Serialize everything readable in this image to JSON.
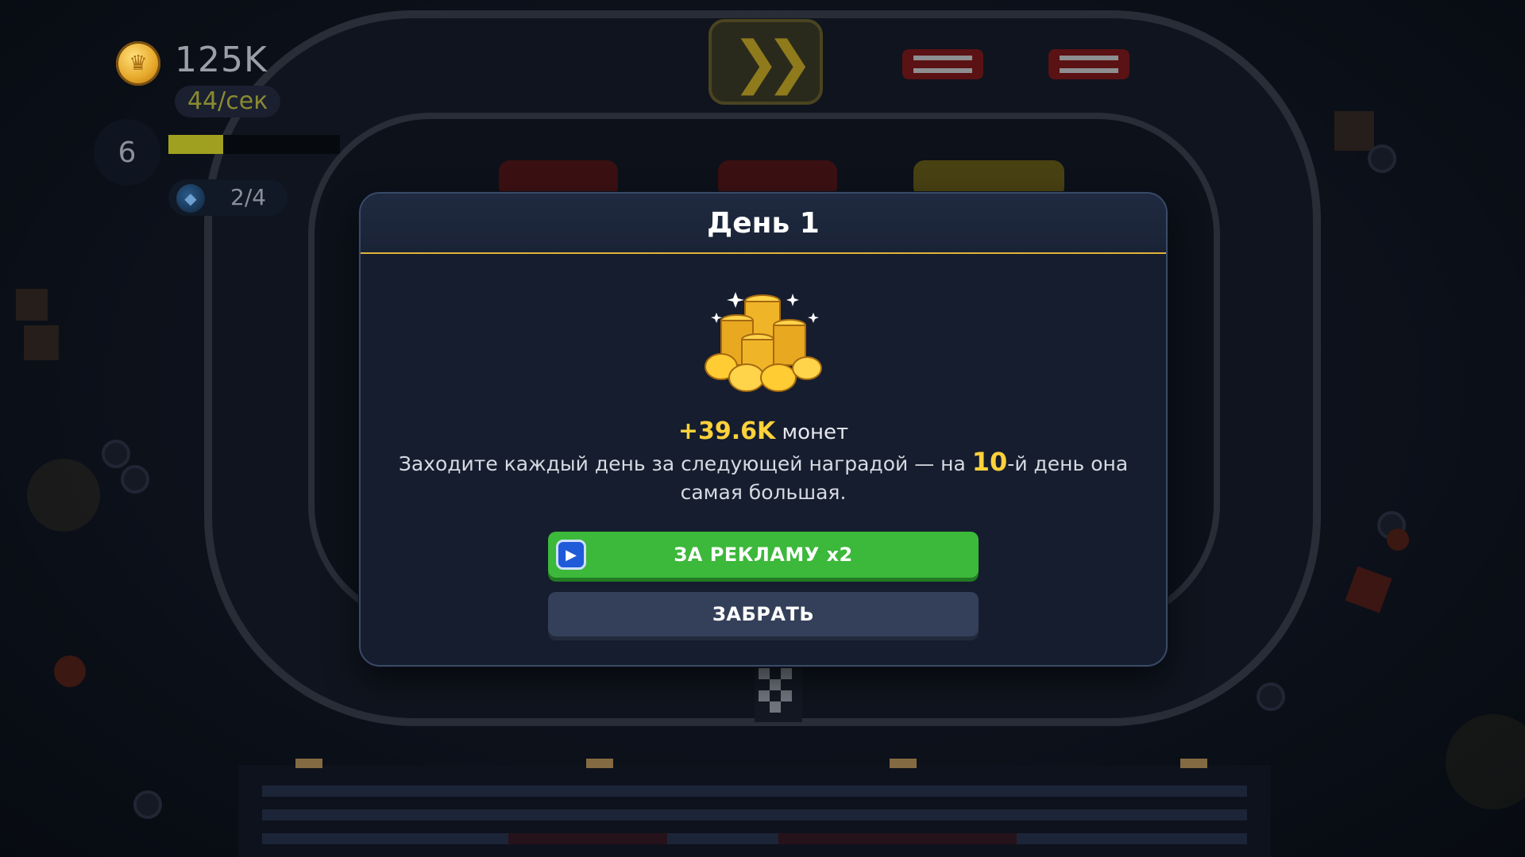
{
  "hud": {
    "coins": "125K",
    "rate": "44/сек",
    "level": "6",
    "xp_progress_fraction": 0.32,
    "gems": "2/4",
    "coin_icon": "crown-coin-icon",
    "gem_icon": "blue-gem-icon",
    "speed_icon": "fast-forward-icon"
  },
  "modal": {
    "title": "День 1",
    "reward_icon": "coin-pile-icon",
    "reward_amount": "+39.6K",
    "reward_unit": "монет",
    "desc_before": "Заходите каждый день за следующей наградой — на ",
    "desc_number": "10",
    "desc_after": "-й день она самая большая.",
    "ad_button_label": "ЗА РЕКЛАМУ x2",
    "ad_button_icon": "play-video-icon",
    "claim_button_label": "ЗАБРАТЬ"
  },
  "colors": {
    "accent_gold": "#ffd13a",
    "header_divider": "#e2b23a",
    "ad_button": "#3cb83a",
    "claim_button": "#34405a",
    "panel": "#151d2e"
  }
}
